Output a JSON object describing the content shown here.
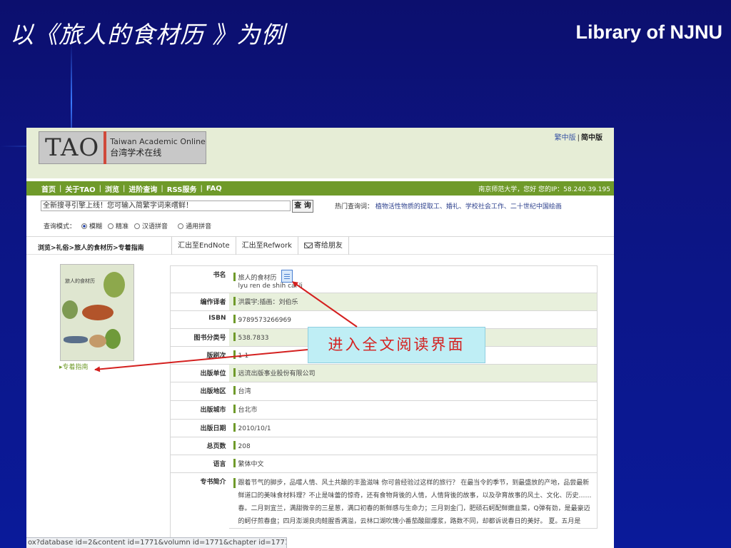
{
  "slide": {
    "title": "以《旅人的食材历 》为例",
    "library": "Library of NJNU",
    "callout": "进入全文阅读界面"
  },
  "site": {
    "logo_main": "TAO",
    "logo_en": "Taiwan Academic Online",
    "logo_cn": "台湾学术在线",
    "lang_trad": "繁中版",
    "lang_simp": "简中版",
    "nav": [
      "首页",
      "关于TAO",
      "浏览",
      "进阶查询",
      "RSS服务",
      "FAQ"
    ],
    "user_info": "南京师范大学，您好   您的IP：58.240.39.195"
  },
  "search": {
    "value": "全新搜寻引擎上线！您可输入简繁字词来嚐鲜！",
    "button": "查 询",
    "hot_label": "热门查询词：",
    "hot_terms": "植物活性物质的提取工、婚礼、学校社会工作、二十世纪中国绘画",
    "mode_label": "查询模式：",
    "modes": [
      "模糊",
      "精准",
      "汉语拼音",
      "通用拼音"
    ]
  },
  "breadcrumb": "浏览>礼俗>旅人的食材历>专着指南",
  "tabs": [
    "汇出至EndNote",
    "汇出至Refwork",
    "寄给朋友"
  ],
  "book": {
    "cover_title": "旅人的食材历",
    "guide_link": "专着指南",
    "fields": [
      {
        "label": "书名",
        "value": "旅人的食材历",
        "value2": "lyu ren de shih cai li"
      },
      {
        "label": "编作译者",
        "value": "洪震宇;插画：刘伯乐"
      },
      {
        "label": "ISBN",
        "value": "9789573266969"
      },
      {
        "label": "图书分类号",
        "value": "538.7833"
      },
      {
        "label": "版刷次",
        "value": "1-1"
      },
      {
        "label": "出版单位",
        "value": "远流出版事业股份有限公司"
      },
      {
        "label": "出版地区",
        "value": "台湾"
      },
      {
        "label": "出版城市",
        "value": "台北市"
      },
      {
        "label": "出版日期",
        "value": "2010/10/1"
      },
      {
        "label": "总页数",
        "value": "208"
      },
      {
        "label": "语言",
        "value": "繁体中文"
      },
      {
        "label": "专书简介",
        "value": "跟着节气的脚步，品嚐人情、风土共酿的丰盈滋味 你可曾经验过这样的旅行？ 在最当令的季节，到最盛放的产地，品尝最新鲜道口的美味食材料理？不止是味蕾的惊奇，还有食物背後的人情，人情背後的故事，以及孕育故事的风土、文化、历史……春。二月到宜兰，满甜微辛的三星葱，满口初春的新鲜感与生命力；三月到金门，肥硕石蚵配鲜嫩韭菜，Q弹有劲，是最豪迈的蚵仔煎春盘；四月澎湖良肉鲑腥香满溢，云林口湖吹瑰小番茄酸甜爆浆，路数不同，却都诉说春日的美好。 夏。五月是"
      }
    ]
  },
  "status_bar": "ox?database id=2&content id=1771&volumn id=1771&chapter id=1771"
}
